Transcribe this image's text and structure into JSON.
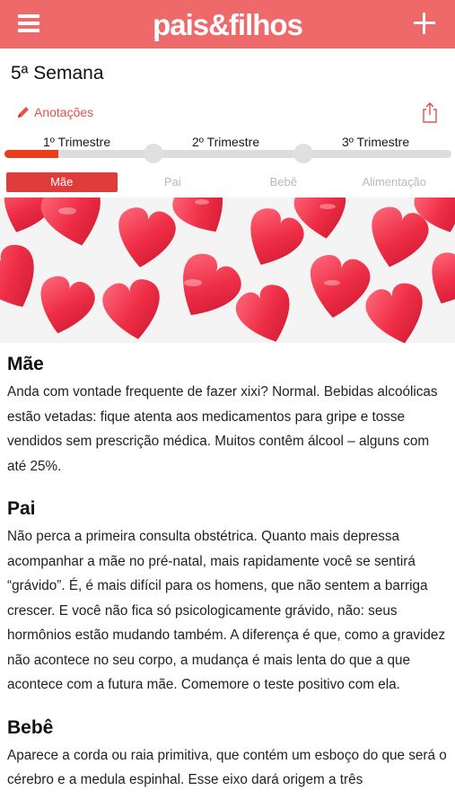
{
  "app": {
    "logo": "pais&filhos"
  },
  "header": {
    "title": "5ª Semana"
  },
  "toolbar": {
    "notes_label": "Anotações"
  },
  "trimesters": {
    "labels": [
      "1º Trimestre",
      "2º Trimestre",
      "3º Trimestre"
    ],
    "progress": 0.12
  },
  "tabs": [
    {
      "label": "Mãe",
      "active": true
    },
    {
      "label": "Pai",
      "active": false
    },
    {
      "label": "Bebê",
      "active": false
    },
    {
      "label": "Alimentação",
      "active": false
    }
  ],
  "colors": {
    "brand": "#ee6a6a",
    "accent": "#e03c3c",
    "progress": "#ee3b1b",
    "heart": "#f0304a"
  },
  "sections": [
    {
      "title": "Mãe",
      "text": "Anda com vontade frequente de fazer xixi? Normal. Bebidas alcoólicas estão vetadas: fique atenta aos medicamentos para gripe e tosse vendidos sem prescrição médica. Muitos contêm álcool – alguns com até 25%."
    },
    {
      "title": "Pai",
      "text": "Não perca a primeira consulta obstétrica. Quanto mais depressa acompanhar a mãe no pré-natal, mais rapidamente você se sentirá “grávido”. É, é mais difícil para os homens, que não sentem a barriga crescer. E você não fica só psicologicamente grávido, não: seus hormônios estão mudando também. A diferença é que, como a gravidez não acontece no seu corpo, a mudança é mais lenta do que a que acontece com a futura mãe. Comemore o teste positivo com ela."
    },
    {
      "title": "Bebê",
      "text": "Aparece a corda ou raia primitiva, que contém um esboço do que será o cérebro e a medula espinhal. Esse eixo dará origem a três"
    }
  ]
}
